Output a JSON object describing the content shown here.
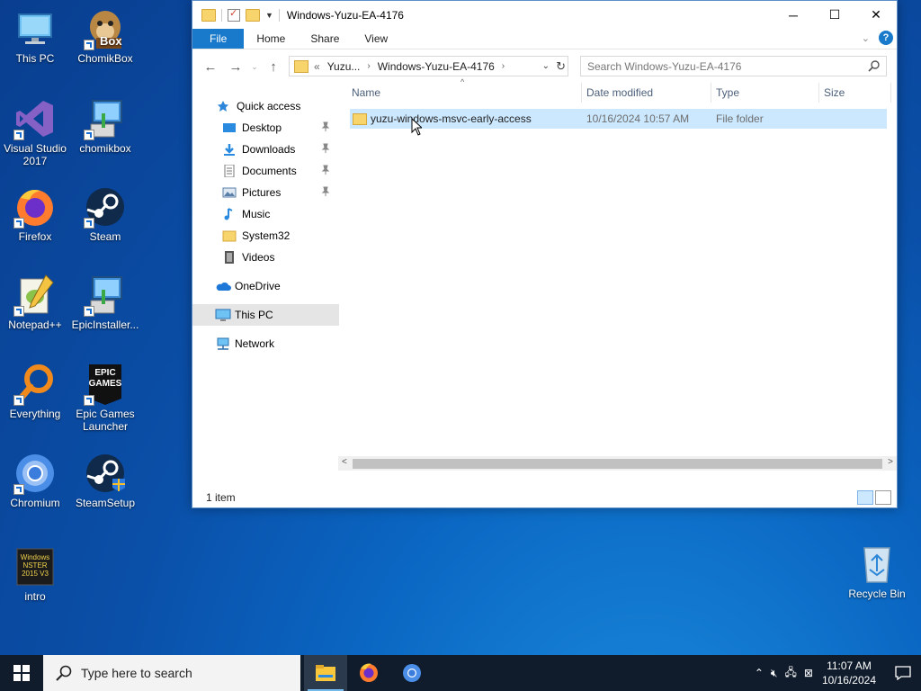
{
  "desktop": {
    "icons": [
      {
        "label": "This PC",
        "icon": "monitor-icon"
      },
      {
        "label": "ChomikBox",
        "icon": "hamster-box-icon",
        "badge": "Box"
      },
      {
        "label": "Visual Studio 2017",
        "icon": "visual-studio-icon"
      },
      {
        "label": "chomikbox",
        "icon": "installer-icon"
      },
      {
        "label": "Firefox",
        "icon": "firefox-icon"
      },
      {
        "label": "Steam",
        "icon": "steam-icon"
      },
      {
        "label": "Notepad++",
        "icon": "notepadpp-icon"
      },
      {
        "label": "EpicInstaller...",
        "icon": "installer-icon"
      },
      {
        "label": "Everything",
        "icon": "magnifier-icon"
      },
      {
        "label": "Epic Games Launcher",
        "icon": "epic-games-icon",
        "badge": "EPIC\nGAMES"
      },
      {
        "label": "Chromium",
        "icon": "chromium-icon"
      },
      {
        "label": "SteamSetup",
        "icon": "steam-setup-icon"
      },
      {
        "label": "intro",
        "icon": "video-thumb-icon",
        "badge": "Windows\nNSTER\n2015 V3"
      },
      {
        "label": "Recycle Bin",
        "icon": "recycle-bin-icon"
      }
    ]
  },
  "explorer": {
    "title": "Windows-Yuzu-EA-4176",
    "ribbon_tabs": [
      "File",
      "Home",
      "Share",
      "View"
    ],
    "address": {
      "prefix": "«",
      "crumbs": [
        "Yuzu...",
        "Windows-Yuzu-EA-4176"
      ]
    },
    "search_placeholder": "Search Windows-Yuzu-EA-4176",
    "nav": {
      "quick_access": "Quick access",
      "items": [
        {
          "label": "Desktop",
          "pinned": true
        },
        {
          "label": "Downloads",
          "pinned": true
        },
        {
          "label": "Documents",
          "pinned": true
        },
        {
          "label": "Pictures",
          "pinned": true
        },
        {
          "label": "Music",
          "pinned": false
        },
        {
          "label": "System32",
          "pinned": false
        },
        {
          "label": "Videos",
          "pinned": false
        }
      ],
      "onedrive": "OneDrive",
      "this_pc": "This PC",
      "network": "Network"
    },
    "columns": [
      "Name",
      "Date modified",
      "Type",
      "Size"
    ],
    "rows": [
      {
        "name": "yuzu-windows-msvc-early-access",
        "date": "10/16/2024 10:57 AM",
        "type": "File folder",
        "size": ""
      }
    ],
    "status": "1 item"
  },
  "taskbar": {
    "search_placeholder": "Type here to search",
    "time": "11:07 AM",
    "date": "10/16/2024"
  },
  "colors": {
    "accent": "#1979ca",
    "selection": "#cce8ff",
    "taskbar": "#101c2c"
  }
}
